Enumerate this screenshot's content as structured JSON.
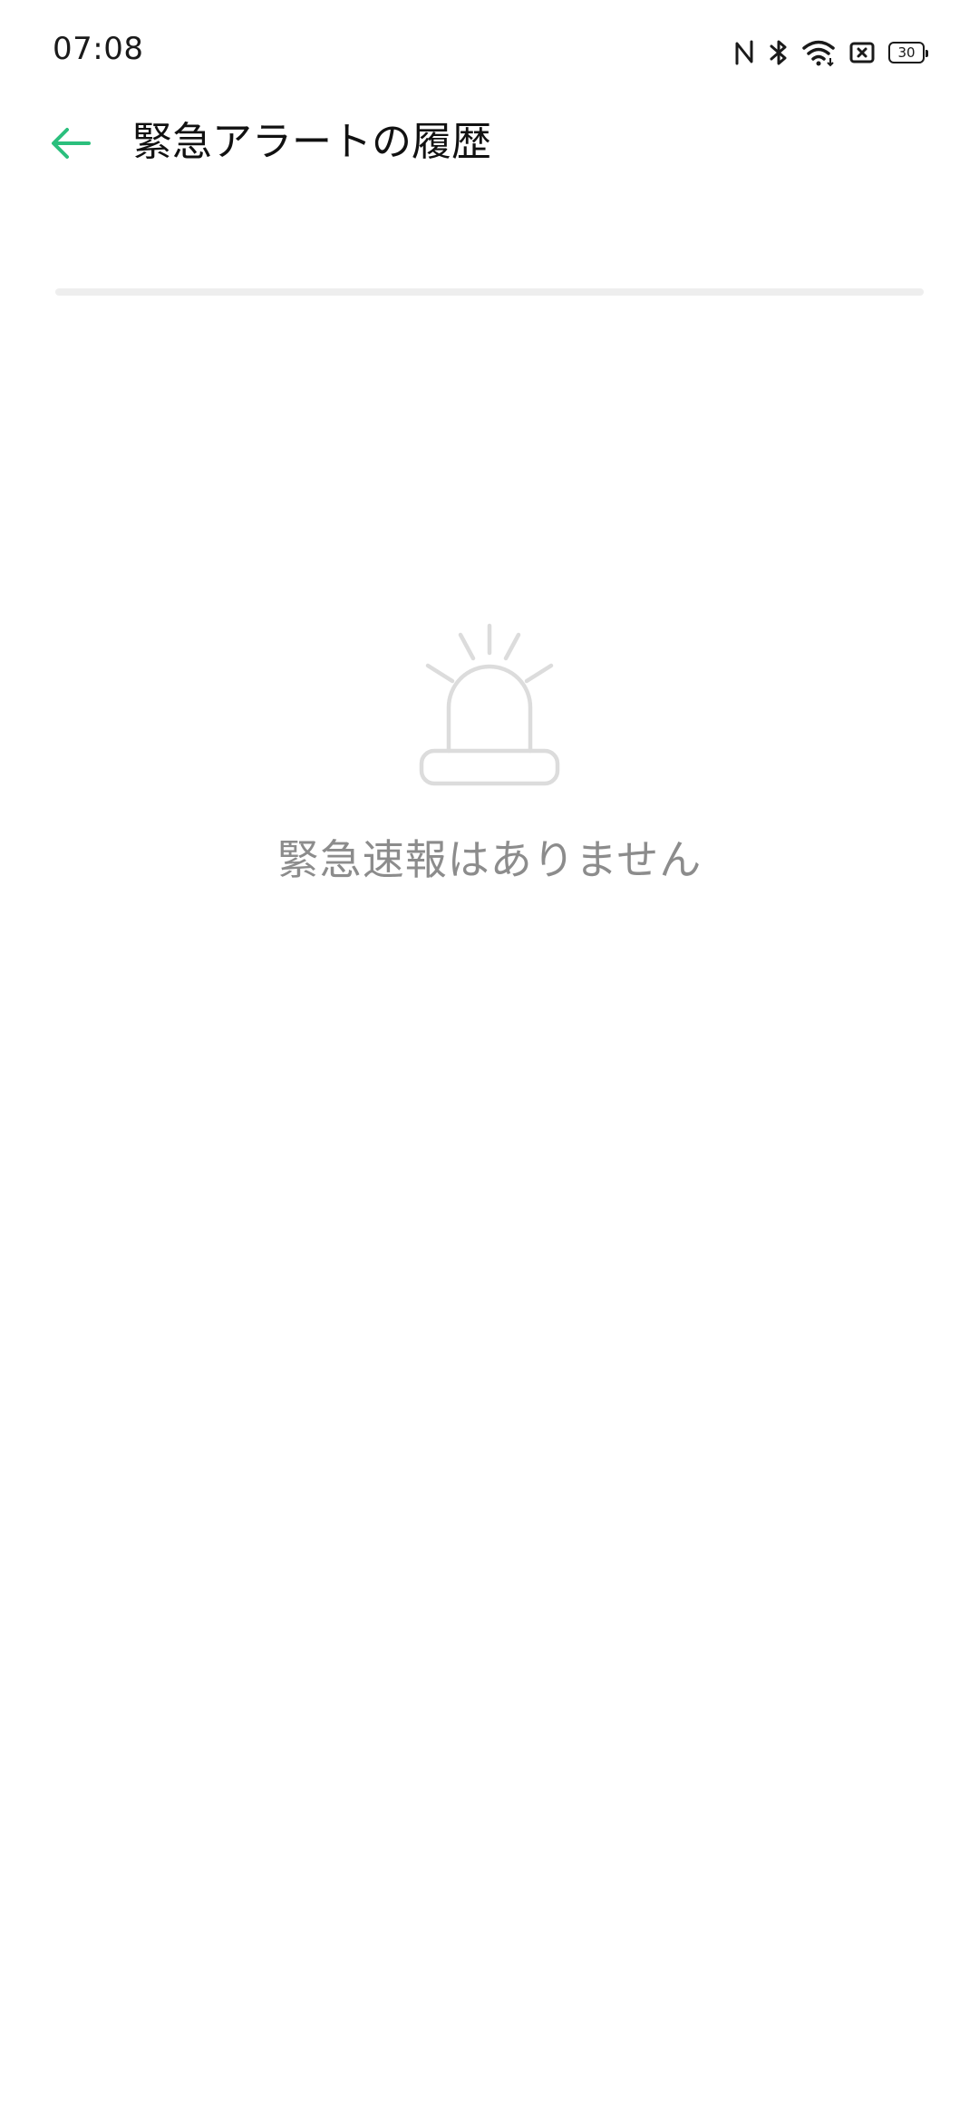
{
  "status_bar": {
    "time": "07:08",
    "battery_level": "30",
    "icons": [
      "nfc-icon",
      "bluetooth-icon",
      "wifi-icon",
      "sim-off-icon",
      "battery-icon"
    ]
  },
  "toolbar": {
    "back_icon": "arrow-left-icon",
    "title": "緊急アラートの履歴"
  },
  "empty_state": {
    "icon": "siren-icon",
    "message": "緊急速報はありません"
  },
  "colors": {
    "accent": "#2bbf7d",
    "title_text": "#111111",
    "empty_text": "#8c8c8c",
    "empty_icon": "#dcdcdc",
    "divider": "#eeeeee",
    "background": "#ffffff"
  }
}
